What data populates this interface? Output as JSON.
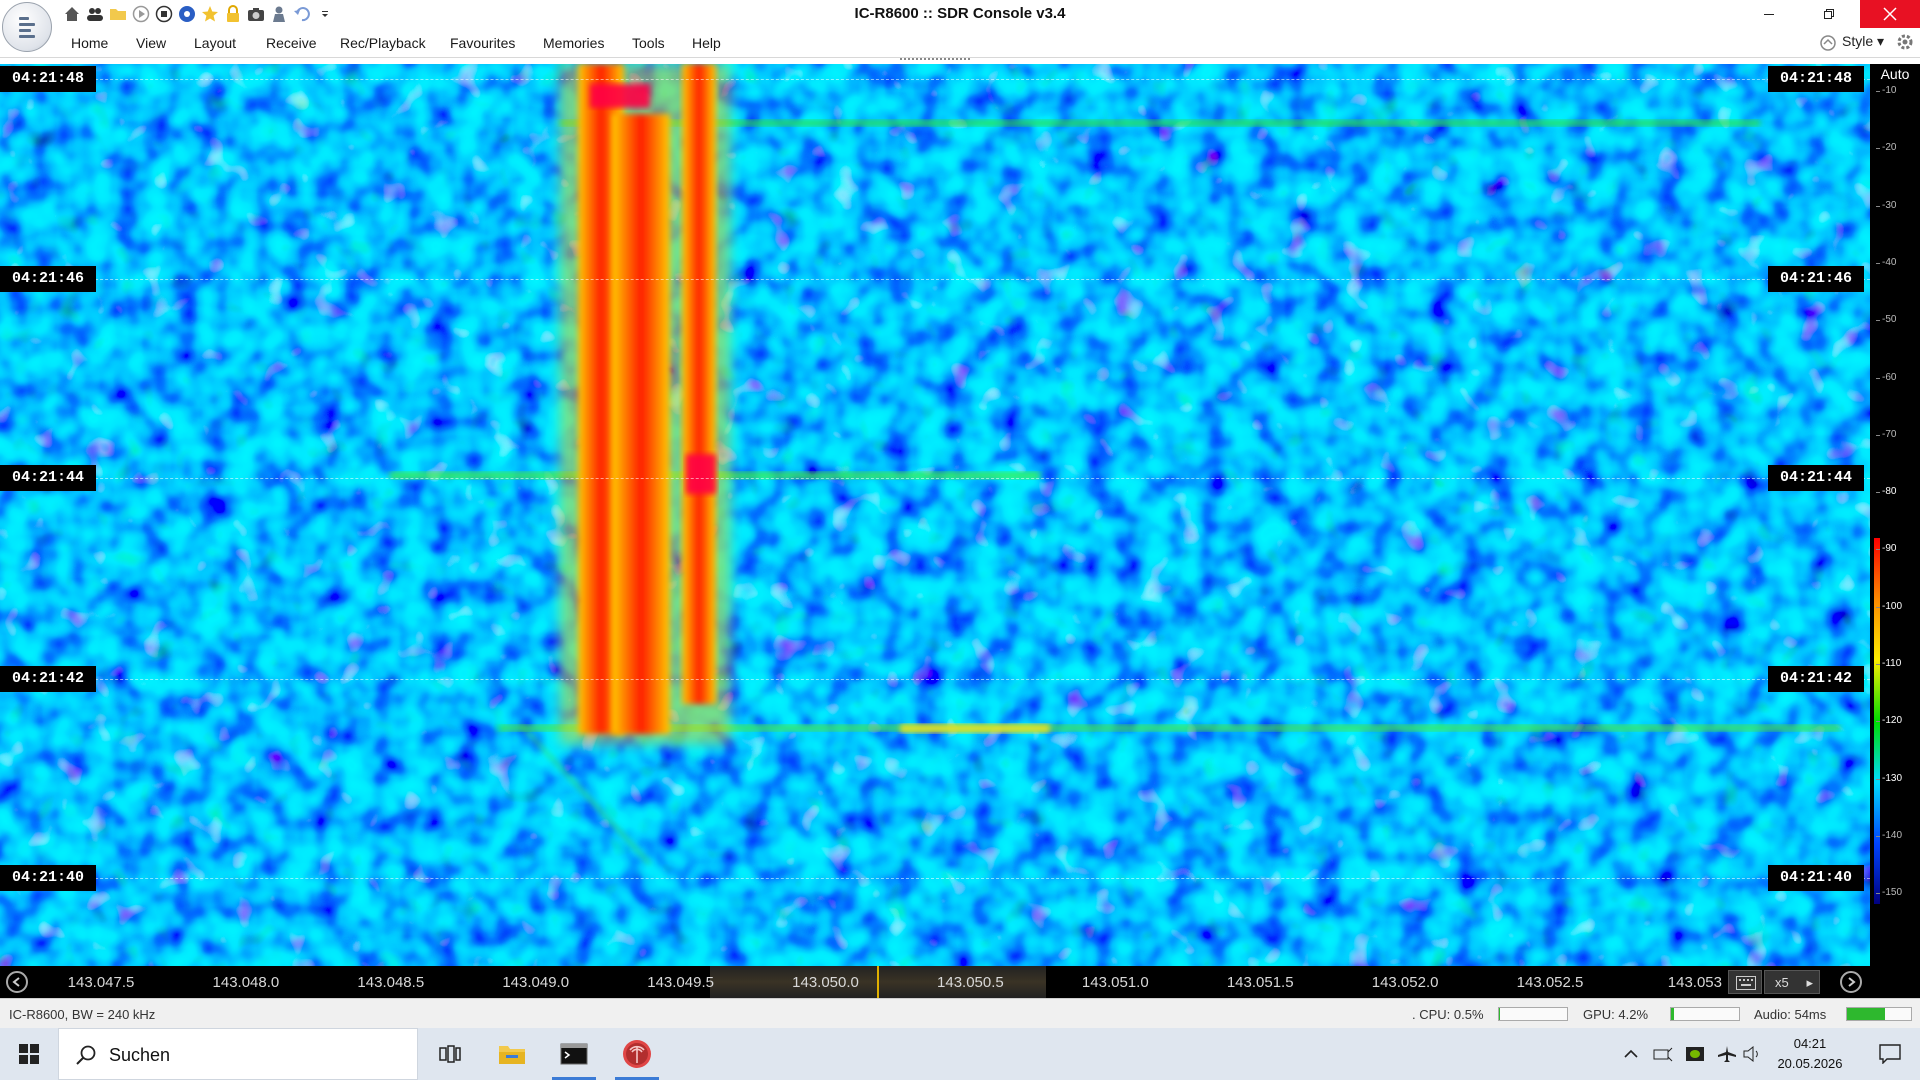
{
  "window": {
    "title": "IC-R8600 :: SDR Console v3.4",
    "close_color": "#e81123"
  },
  "quick_access": [
    "home-icon",
    "users-icon",
    "folder-icon",
    "play-icon",
    "stop-icon",
    "record-icon",
    "star-icon",
    "lock-icon",
    "camera-icon",
    "person-icon",
    "undo-icon",
    "dropdown-icon"
  ],
  "menu": {
    "items": [
      "Home",
      "View",
      "Layout",
      "Receive",
      "Rec/Playback",
      "Favourites",
      "Memories",
      "Tools",
      "Help"
    ],
    "style_label": "Style"
  },
  "waterfall": {
    "time_labels": [
      "04:21:48",
      "04:21:46",
      "04:21:44",
      "04:21:42",
      "04:21:40"
    ],
    "colormap": [
      "#000040",
      "#0000c0",
      "#0050ff",
      "#00c8ff",
      "#00e000",
      "#ffee00",
      "#ff8800",
      "#ff0000"
    ]
  },
  "db_scale": {
    "mode_label": "Auto",
    "ticks": [
      "-10",
      "-20",
      "-30",
      "-40",
      "-50",
      "-60",
      "-70",
      "-80",
      "-90",
      "-100",
      "-110",
      "-120",
      "-130",
      "-140",
      "-150"
    ],
    "visible_range_db": [
      -130,
      -80
    ]
  },
  "frequency_axis": {
    "ticks": [
      "143.047.5",
      "143.048.0",
      "143.048.5",
      "143.049.0",
      "143.049.5",
      "143.050.0",
      "143.050.5",
      "143.051.0",
      "143.051.5",
      "143.052.0",
      "143.052.5",
      "143.053"
    ],
    "zoom_label": "x5"
  },
  "status": {
    "device": "IC-R8600, BW = 240 kHz",
    "cpu": ". CPU: 0.5%",
    "gpu": "GPU: 4.2%",
    "audio": "Audio: 54ms",
    "cpu_level": 0.005,
    "gpu_level": 0.042,
    "audio_level": 0.6
  },
  "taskbar": {
    "search_placeholder": "Suchen",
    "time": "04:21",
    "date": "20.05.2026"
  }
}
